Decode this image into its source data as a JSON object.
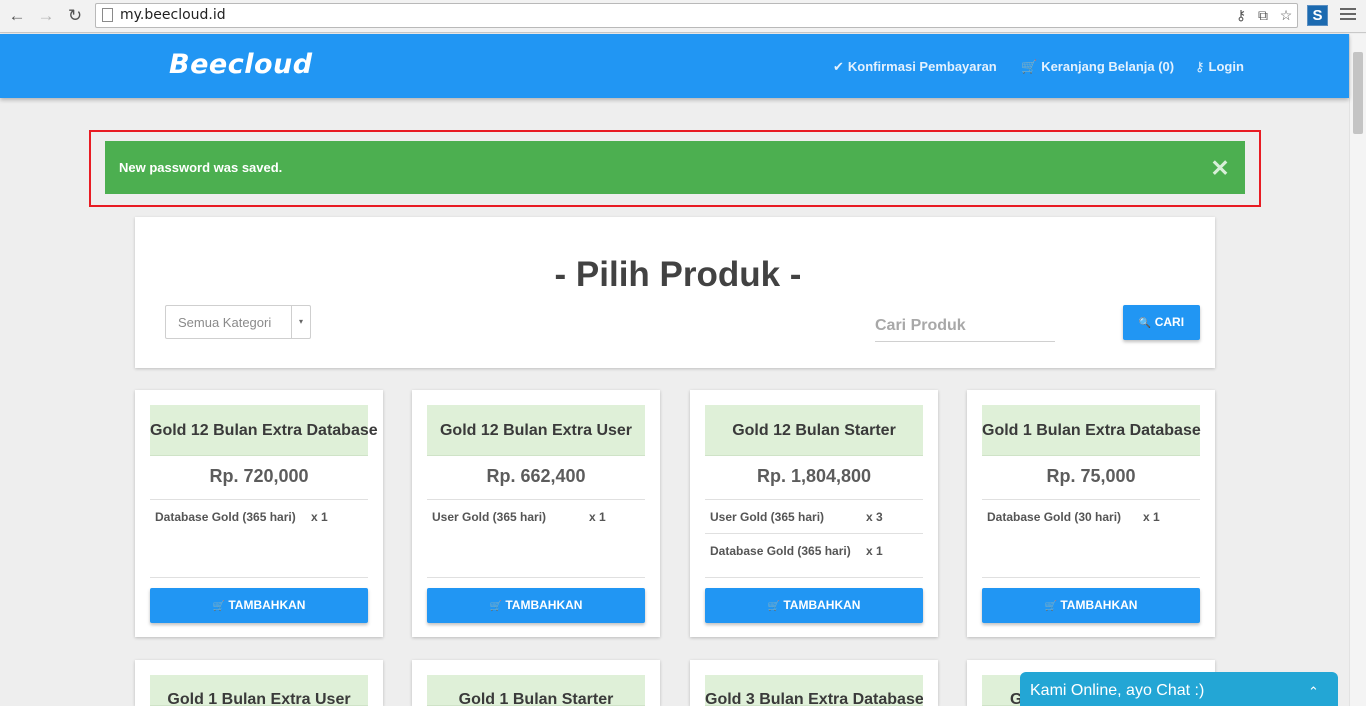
{
  "browser": {
    "url": "my.beecloud.id",
    "back_glyph": "←",
    "forward_glyph": "→",
    "reload_glyph": "↻",
    "ext_label": "S"
  },
  "site": {
    "logo": "Beecloud",
    "nav": [
      {
        "icon": "✔",
        "label": "Konfirmasi Pembayaran"
      },
      {
        "icon": "🛒",
        "label": "Keranjang Belanja (0)"
      },
      {
        "icon": "⚷",
        "label": "Login"
      }
    ]
  },
  "alert": {
    "message": "New password was saved.",
    "close": "✕",
    "color": "#4caf50",
    "highlight_color": "#e81b23"
  },
  "panel": {
    "title": "- Pilih Produk -",
    "category_select": {
      "value": "Semua Kategori",
      "arrow": "▾"
    },
    "search_placeholder": "Cari Produk",
    "search_button": "CARI",
    "search_icon": "🔍"
  },
  "products": [
    {
      "name": "Gold 12 Bulan Extra Database",
      "price": "Rp. 720,000",
      "features": [
        {
          "label": "Database Gold (365 hari)",
          "qty": "x 1"
        }
      ],
      "button": "TAMBAHKAN"
    },
    {
      "name": "Gold 12 Bulan Extra User",
      "price": "Rp. 662,400",
      "features": [
        {
          "label": "User Gold (365 hari)",
          "qty": "x 1"
        }
      ],
      "button": "TAMBAHKAN"
    },
    {
      "name": "Gold 12 Bulan Starter",
      "price": "Rp. 1,804,800",
      "features": [
        {
          "label": "User Gold (365 hari)",
          "qty": "x 3"
        },
        {
          "label": "Database Gold (365 hari)",
          "qty": "x 1"
        }
      ],
      "button": "TAMBAHKAN"
    },
    {
      "name": "Gold 1 Bulan Extra Database",
      "price": "Rp. 75,000",
      "features": [
        {
          "label": "Database Gold (30 hari)",
          "qty": "x 1"
        }
      ],
      "button": "TAMBAHKAN"
    },
    {
      "name": "Gold 1 Bulan Extra User"
    },
    {
      "name": "Gold 1 Bulan Starter"
    },
    {
      "name": "Gold 3 Bulan Extra Database"
    },
    {
      "name": "G"
    }
  ],
  "cart_icon": "🛒",
  "chat": {
    "label": "Kami Online, ayo Chat :)",
    "chevron": "⌃"
  },
  "colors": {
    "primary": "#2196f3",
    "card_header": "#dff0d8",
    "chat": "#23a6d5"
  }
}
